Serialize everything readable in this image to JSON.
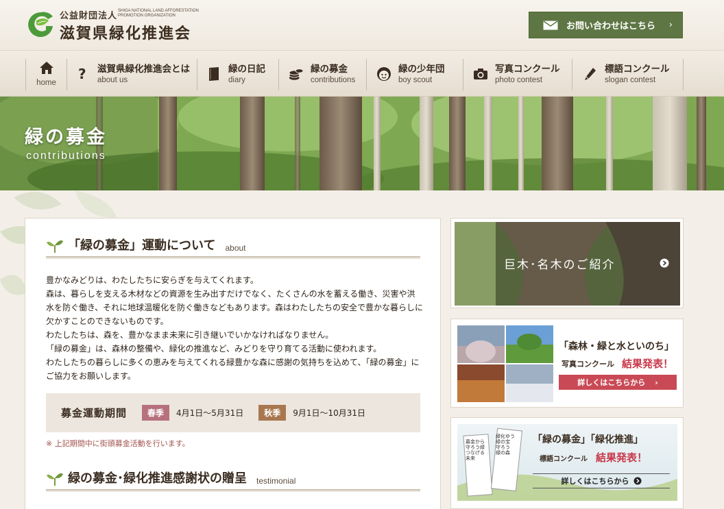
{
  "header": {
    "org_type": "公益財団法人",
    "org_name_en": "SHIGA NATIONAL LAND AFFORESTATION PROMOTION ORGANIZATION",
    "org_name": "滋賀県緑化推進会",
    "contact_label": "お問い合わせはこちら",
    "contact_chevron": "›",
    "brand_color": "#5e7644"
  },
  "nav": {
    "items": [
      {
        "jp": "",
        "en": "home",
        "icon": "home-icon"
      },
      {
        "jp": "滋賀県緑化推進会とは",
        "en": "about us",
        "icon": "question-icon"
      },
      {
        "jp": "緑の日記",
        "en": "diary",
        "icon": "book-icon"
      },
      {
        "jp": "緑の募金",
        "en": "contributions",
        "icon": "coins-icon"
      },
      {
        "jp": "緑の少年団",
        "en": "boy scout",
        "icon": "face-icon"
      },
      {
        "jp": "写真コンクール",
        "en": "photo contest",
        "icon": "camera-icon"
      },
      {
        "jp": "標語コンクール",
        "en": "slogan contest",
        "icon": "pencil-icon"
      }
    ]
  },
  "hero": {
    "title": "緑の募金",
    "subtitle": "contributions"
  },
  "about": {
    "title": "「緑の募金」運動について",
    "tag": "about",
    "paragraphs": [
      "豊かなみどりは、わたしたちに安らぎを与えてくれます。",
      "森は、暮らしを支える木材などの資源を生み出すだけでなく、たくさんの水を蓄える働き、災害や洪水を防ぐ働き、それに地球温暖化を防ぐ働きなどもあります。森はわたしたちの安全で豊かな暮らしに欠かすことのできないものです。",
      "わたしたちは、森を、豊かなまま未来に引き継いでいかなければなりません。",
      "「緑の募金」は、森林の整備や、緑化の推進など、みどりを守り育てる活動に使われます。",
      "わたしたちの暮らしに多くの恵みを与えてくれる緑豊かな森に感謝の気持ちを込めて、「緑の募金」にご協力をお願いします。"
    ],
    "period_label": "募金運動期間",
    "spring_badge": "春季",
    "spring_range": "4月1日～5月31日",
    "autumn_badge": "秋季",
    "autumn_range": "9月1日～10月31日",
    "note": "※ 上記期間中に街頭募金活動を行います。"
  },
  "testimonial": {
    "title": "緑の募金･緑化推進感謝状の贈呈",
    "tag": "testimonial"
  },
  "sidebar": {
    "trees_banner": "巨木･名木のご紹介",
    "photo_banner_title": "「森林・緑と水といのち」",
    "photo_banner_sub": "写真コンクール",
    "photo_banner_result": "結果発表！",
    "photo_banner_btn": "詳しくはこちらから",
    "slogan_banner_title": "「緑の募金」「緑化推進」",
    "slogan_banner_sub": "標語コンクール",
    "slogan_banner_result": "結果発表！",
    "slogan_banner_btn": "詳しくはこちらから",
    "slogan_card_1": "募金から守ろう緑 つなげる未来",
    "slogan_card_2": "緑化ゆう緑の宝 守ろう 緑の森"
  }
}
